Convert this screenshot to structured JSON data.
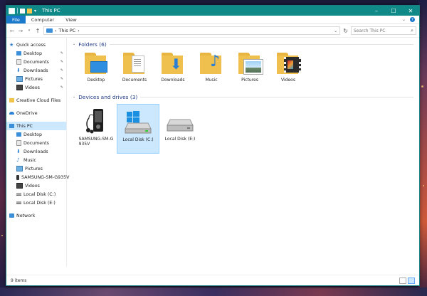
{
  "window": {
    "title": "This PC"
  },
  "ribbon": {
    "tabs": [
      {
        "label": "File",
        "active": true
      },
      {
        "label": "Computer"
      },
      {
        "label": "View"
      }
    ]
  },
  "address": {
    "path": "This PC",
    "search_placeholder": "Search This PC"
  },
  "sidebar": {
    "items": [
      {
        "label": "Quick access",
        "level": 1,
        "icon": "star-icon"
      },
      {
        "label": "Desktop",
        "level": 2,
        "icon": "desktop-icon",
        "pinned": true
      },
      {
        "label": "Documents",
        "level": 2,
        "icon": "documents-icon",
        "pinned": true
      },
      {
        "label": "Downloads",
        "level": 2,
        "icon": "downloads-icon",
        "pinned": true
      },
      {
        "label": "Pictures",
        "level": 2,
        "icon": "pictures-icon",
        "pinned": true
      },
      {
        "label": "Videos",
        "level": 2,
        "icon": "videos-icon",
        "pinned": true
      },
      {
        "label": "Creative Cloud Files",
        "level": 1,
        "icon": "creative-cloud-icon"
      },
      {
        "label": "OneDrive",
        "level": 1,
        "icon": "onedrive-icon"
      },
      {
        "label": "This PC",
        "level": 1,
        "icon": "computer-icon",
        "selected": true
      },
      {
        "label": "Desktop",
        "level": 2,
        "icon": "desktop-icon"
      },
      {
        "label": "Documents",
        "level": 2,
        "icon": "documents-icon"
      },
      {
        "label": "Downloads",
        "level": 2,
        "icon": "downloads-icon"
      },
      {
        "label": "Music",
        "level": 2,
        "icon": "music-icon"
      },
      {
        "label": "Pictures",
        "level": 2,
        "icon": "pictures-icon"
      },
      {
        "label": "SAMSUNG-SM-G935V",
        "level": 2,
        "icon": "phone-icon"
      },
      {
        "label": "Videos",
        "level": 2,
        "icon": "videos-icon"
      },
      {
        "label": "Local Disk (C:)",
        "level": 2,
        "icon": "drive-icon"
      },
      {
        "label": "Local Disk (E:)",
        "level": 2,
        "icon": "drive-icon"
      },
      {
        "label": "Network",
        "level": 1,
        "icon": "network-icon"
      }
    ]
  },
  "folders": {
    "header": "Folders (6)",
    "items": [
      {
        "label": "Desktop",
        "icon": "desktop-folder-icon"
      },
      {
        "label": "Documents",
        "icon": "documents-folder-icon"
      },
      {
        "label": "Downloads",
        "icon": "downloads-folder-icon"
      },
      {
        "label": "Music",
        "icon": "music-folder-icon"
      },
      {
        "label": "Pictures",
        "icon": "pictures-folder-icon"
      },
      {
        "label": "Videos",
        "icon": "videos-folder-icon"
      }
    ]
  },
  "devices": {
    "header": "Devices and drives (3)",
    "items": [
      {
        "label": "SAMSUNG-SM-G\n935V",
        "icon": "phone-device-icon"
      },
      {
        "label": "Local Disk (C:)",
        "icon": "windows-drive-icon",
        "selected": true
      },
      {
        "label": "Local Disk (E:)",
        "icon": "hard-drive-icon"
      }
    ]
  },
  "status": {
    "count": "9 items"
  },
  "colors": {
    "titlebar": "#108a88",
    "accent": "#1979ca",
    "selection": "#cce8ff",
    "folder": "#ffd866"
  }
}
